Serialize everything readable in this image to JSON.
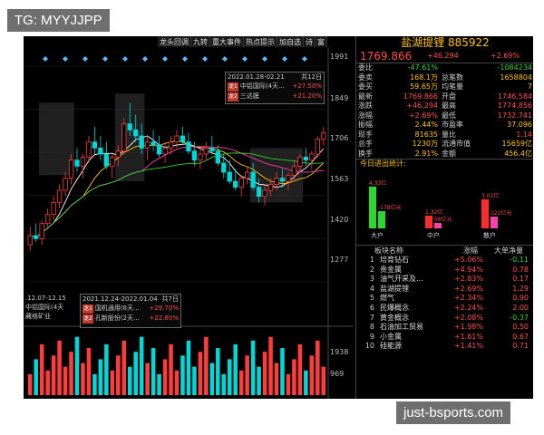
{
  "watermarks": {
    "top": "TG: MYYJJPP",
    "bottom": "just-bsports.com"
  },
  "toolbar": [
    "龙头回调",
    "九转",
    "重大事件",
    "热点提示",
    "加自选",
    "诗",
    "富"
  ],
  "price_axis": [
    "1991",
    "1849",
    "1706",
    "1563",
    "1420",
    "1277",
    "1938",
    "969"
  ],
  "info_box": {
    "period": "2022.01.28-02.21",
    "count": "共12日",
    "rows": [
      {
        "tag": "龙1",
        "name": "中铝国际(4天...",
        "value": "+27.50%"
      },
      {
        "tag": "龙2",
        "name": "三达膜",
        "value": "+21.20%"
      }
    ]
  },
  "info_box_left": {
    "period": ".12.07-12.15",
    "rows": [
      {
        "name": "中铝国际(4天"
      },
      {
        "name": "藏格矿业"
      }
    ]
  },
  "info_box_mid": {
    "period": "2021.12.24-2022.01.04",
    "count": "共7日",
    "rows": [
      {
        "tag": "龙1",
        "name": "国机通用(6天...",
        "value": "+29.70%"
      },
      {
        "tag": "龙2",
        "name": "孔新股份(2天...",
        "value": "+22.80%"
      }
    ]
  },
  "stock": {
    "name_code": "盐湖提锂 885922",
    "price": "1769.866",
    "change": "+46.294",
    "pct": "+2.69%"
  },
  "quotes": [
    {
      "l1": "委比",
      "v1": "-47.61%",
      "c1": "#2fd62f",
      "l2": "",
      "v2": "-1084234",
      "c2": "#2fd62f"
    },
    {
      "l1": "委卖",
      "v1": "168.1万",
      "c1": "#ffc400",
      "l2": "总笔数",
      "v2": "1658804",
      "c2": "#ffc400"
    },
    {
      "l1": "委买",
      "v1": "59.65万",
      "c1": "#ffc400",
      "l2": "均笔量",
      "v2": "7",
      "c2": "#ffc400"
    },
    {
      "l1": "最新",
      "v1": "1769.866",
      "c1": "#ff4b4b",
      "l2": "开盘",
      "v2": "1746.584",
      "c2": "#ff4b4b"
    },
    {
      "l1": "涨跌",
      "v1": "+46.294",
      "c1": "#ff4b4b",
      "l2": "最高",
      "v2": "1774.856",
      "c2": "#ff4b4b"
    },
    {
      "l1": "涨幅",
      "v1": "+2.69%",
      "c1": "#ff4b4b",
      "l2": "最低",
      "v2": "1732.741",
      "c2": "#ff4b4b"
    },
    {
      "l1": "振幅",
      "v1": "2.44%",
      "c1": "#ffc400",
      "l2": "市盈率",
      "v2": "37.096",
      "c2": "#ffc400"
    },
    {
      "l1": "现手",
      "v1": "81635",
      "c1": "#ffc400",
      "l2": "量比",
      "v2": "1.14",
      "c2": "#ff4b4b"
    },
    {
      "l1": "总手",
      "v1": "1230万",
      "c1": "#ffc400",
      "l2": "流通市值",
      "v2": "15659亿",
      "c2": "#ffc400"
    },
    {
      "l1": "换手",
      "v1": "2.91%",
      "c1": "#ffc400",
      "l2": "金额",
      "v2": "456.4亿",
      "c2": "#ffc400"
    }
  ],
  "flow": {
    "title": "今日进出统计:",
    "groups": [
      {
        "name": "大户",
        "in_label": "4.33亿",
        "out_label": "-178亿元",
        "in_value": 4.33,
        "out_value": 1.78
      },
      {
        "name": "中户",
        "in_label": "1.32亿",
        "out_label": "56亿元",
        "in_value": 1.32,
        "out_value": 0.56
      },
      {
        "name": "散户",
        "in_label": "3.01亿",
        "out_label": "122亿元",
        "in_value": 3.01,
        "out_value": 1.22
      }
    ],
    "colors": {
      "in": "#2fd62f",
      "out": "#ff2a2a",
      "mid": "#ff3fb0"
    }
  },
  "sector": {
    "headers": [
      "板块名称",
      "涨幅",
      "大单净量"
    ],
    "rows": [
      {
        "no": "1",
        "name": "培育钻石",
        "chg": "+5.06%",
        "net": "-0.11",
        "net_color": "#2fd62f"
      },
      {
        "no": "2",
        "name": "贵金属",
        "chg": "+4.94%",
        "net": "0.78",
        "net_color": "#ff4b4b"
      },
      {
        "no": "3",
        "name": "油气开采及...",
        "chg": "+2.83%",
        "net": "0.17",
        "net_color": "#ff4b4b"
      },
      {
        "no": "4",
        "name": "盐湖提锂",
        "chg": "+2.69%",
        "net": "1.29",
        "net_color": "#ff4b4b"
      },
      {
        "no": "5",
        "name": "燃气",
        "chg": "+2.34%",
        "net": "0.90",
        "net_color": "#ff4b4b"
      },
      {
        "no": "6",
        "name": "民爆概念",
        "chg": "+2.24%",
        "net": "2.00",
        "net_color": "#ff4b4b"
      },
      {
        "no": "7",
        "name": "黄金概念",
        "chg": "+2.08%",
        "net": "-0.37",
        "net_color": "#2fd62f"
      },
      {
        "no": "8",
        "name": "石油加工贸易",
        "chg": "+1.98%",
        "net": "0.50",
        "net_color": "#ff4b4b"
      },
      {
        "no": "9",
        "name": "小金属",
        "chg": "+1.61%",
        "net": "0.67",
        "net_color": "#ff4b4b"
      },
      {
        "no": "10",
        "name": "硅能源",
        "chg": "+1.41%",
        "net": "0.71",
        "net_color": "#ff4b4b"
      }
    ]
  },
  "candles": [
    [
      1400,
      1460,
      1380,
      1430
    ],
    [
      1430,
      1470,
      1410,
      1420
    ],
    [
      1420,
      1480,
      1400,
      1470
    ],
    [
      1470,
      1520,
      1450,
      1500
    ],
    [
      1500,
      1560,
      1480,
      1540
    ],
    [
      1540,
      1600,
      1520,
      1580
    ],
    [
      1580,
      1640,
      1560,
      1620
    ],
    [
      1620,
      1700,
      1600,
      1680
    ],
    [
      1680,
      1720,
      1640,
      1660
    ],
    [
      1660,
      1700,
      1620,
      1690
    ],
    [
      1690,
      1760,
      1670,
      1740
    ],
    [
      1740,
      1790,
      1700,
      1720
    ],
    [
      1720,
      1760,
      1680,
      1700
    ],
    [
      1700,
      1740,
      1650,
      1660
    ],
    [
      1660,
      1700,
      1620,
      1690
    ],
    [
      1690,
      1730,
      1660,
      1710
    ],
    [
      1710,
      1820,
      1700,
      1800
    ],
    [
      1800,
      1870,
      1760,
      1780
    ],
    [
      1780,
      1830,
      1740,
      1760
    ],
    [
      1760,
      1800,
      1700,
      1720
    ],
    [
      1720,
      1760,
      1680,
      1740
    ],
    [
      1740,
      1780,
      1710,
      1730
    ],
    [
      1730,
      1760,
      1690,
      1700
    ],
    [
      1700,
      1740,
      1670,
      1720
    ],
    [
      1720,
      1760,
      1700,
      1740
    ],
    [
      1740,
      1780,
      1720,
      1760
    ],
    [
      1760,
      1790,
      1730,
      1740
    ],
    [
      1740,
      1770,
      1700,
      1710
    ],
    [
      1710,
      1740,
      1660,
      1680
    ],
    [
      1680,
      1720,
      1650,
      1700
    ],
    [
      1700,
      1740,
      1680,
      1720
    ],
    [
      1720,
      1760,
      1700,
      1710
    ],
    [
      1710,
      1730,
      1660,
      1670
    ],
    [
      1670,
      1700,
      1620,
      1640
    ],
    [
      1640,
      1680,
      1600,
      1610
    ],
    [
      1610,
      1650,
      1580,
      1590
    ],
    [
      1590,
      1630,
      1560,
      1620
    ],
    [
      1620,
      1660,
      1600,
      1640
    ],
    [
      1640,
      1670,
      1580,
      1590
    ],
    [
      1590,
      1620,
      1540,
      1560
    ],
    [
      1560,
      1600,
      1530,
      1580
    ],
    [
      1580,
      1620,
      1560,
      1600
    ],
    [
      1600,
      1640,
      1580,
      1620
    ],
    [
      1620,
      1650,
      1590,
      1610
    ],
    [
      1610,
      1640,
      1580,
      1630
    ],
    [
      1630,
      1680,
      1610,
      1660
    ],
    [
      1660,
      1700,
      1640,
      1690
    ],
    [
      1690,
      1720,
      1660,
      1680
    ],
    [
      1680,
      1710,
      1650,
      1700
    ],
    [
      1700,
      1760,
      1690,
      1750
    ],
    [
      1750,
      1790,
      1730,
      1770
    ]
  ]
}
